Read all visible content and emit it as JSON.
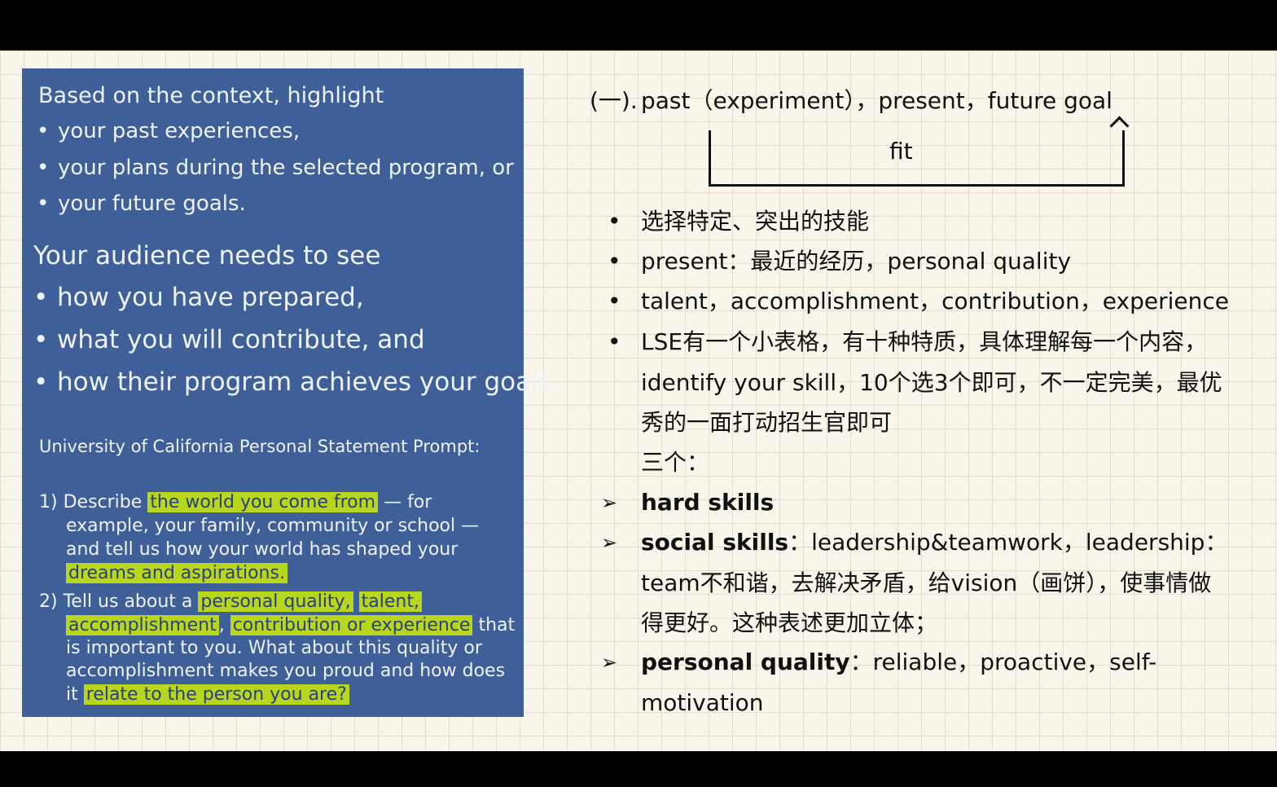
{
  "panel": {
    "intro": "Based on the context, highlight",
    "bullets": [
      "your past experiences,",
      "your plans during the selected program, or",
      "your future goals."
    ],
    "audience_heading": "Your audience needs to see",
    "audience_items": [
      "how you have prepared,",
      "what you will contribute, and",
      "how their program achieves your goals."
    ],
    "uc_heading": "University of California Personal Statement Prompt:",
    "p1_num": "1)",
    "p1_a": "Describe ",
    "p1_h1": "the world you come from",
    "p1_b": " — for",
    "p1_l2": "example, your family, community or school —",
    "p1_l3": "and tell us how your world has shaped your",
    "p1_h2": "dreams and aspirations.",
    "p2_num": "2)",
    "p2_a": "Tell us about a",
    "p2_h1": "personal quality,",
    "p2_h2": "talent,",
    "p2_h3": "accomplishment",
    "p2_comma": ",",
    "p2_h4": "contribution or experience",
    "p2_b": " that",
    "p2_l3": "is important to you. What about this quality or",
    "p2_l4": "accomplishment makes you proud and how does",
    "p2_c": "it ",
    "p2_h5": "relate to the person you are?"
  },
  "notes": {
    "heading_marker": "(一).",
    "heading_text": "past（experiment），present，future goal",
    "fit_label": "fit",
    "bullet1": "选择特定、突出的技能",
    "bullet2": "present：最近的经历，personal quality",
    "bullet3": "talent，accomplishment，contribution，experience",
    "bullet4_l1": "LSE有一个小表格，有十种特质，具体理解每一个内容，",
    "bullet4_l2": "identify your skill，10个选3个即可，不一定完美，最优",
    "bullet4_l3": "秀的一面打动招生官即可",
    "three": "三个：",
    "hard_label": "hard skills",
    "social_label": "social skills",
    "social_text": "：leadership&teamwork，leadership：",
    "social_l2": "team不和谐，去解决矛盾，给vision（画饼），使事情做",
    "social_l3": "得更好。这种表述更加立体；",
    "personal_label": "personal quality",
    "personal_text": "：reliable，proactive，self-",
    "personal_l2": "motivation"
  },
  "bullet_symbol": "•",
  "arrow_symbol": "➢"
}
